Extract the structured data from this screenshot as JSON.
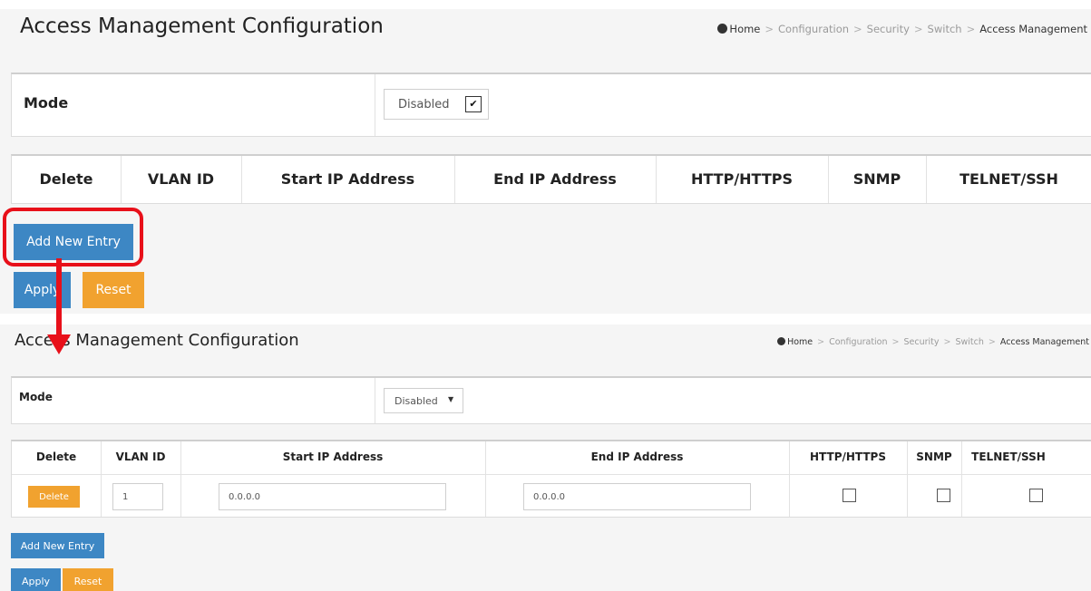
{
  "page": {
    "title": "Access Management Configuration",
    "breadcrumb": [
      "Home",
      "Configuration",
      "Security",
      "Switch",
      "Access Management"
    ],
    "breadcrumb_separator": ">"
  },
  "mode": {
    "label": "Mode",
    "selected": "Disabled"
  },
  "table": {
    "headers": {
      "delete": "Delete",
      "vlan_id": "VLAN ID",
      "start_ip": "Start IP Address",
      "end_ip": "End IP Address",
      "http": "HTTP/HTTPS",
      "snmp": "SNMP",
      "telnet": "TELNET/SSH"
    },
    "rows": [
      {
        "delete_label": "Delete",
        "vlan_id": "1",
        "start_ip": "0.0.0.0",
        "end_ip": "0.0.0.0",
        "http": false,
        "snmp": false,
        "telnet": false
      }
    ]
  },
  "buttons": {
    "add_new_entry": "Add New Entry",
    "apply": "Apply",
    "reset": "Reset"
  },
  "colors": {
    "primary_button": "#3d87c4",
    "secondary_button": "#f1a22f",
    "annotation": "#e8101a"
  },
  "icons": {
    "home": "home-icon",
    "dropdown": "chevron-down-icon"
  }
}
